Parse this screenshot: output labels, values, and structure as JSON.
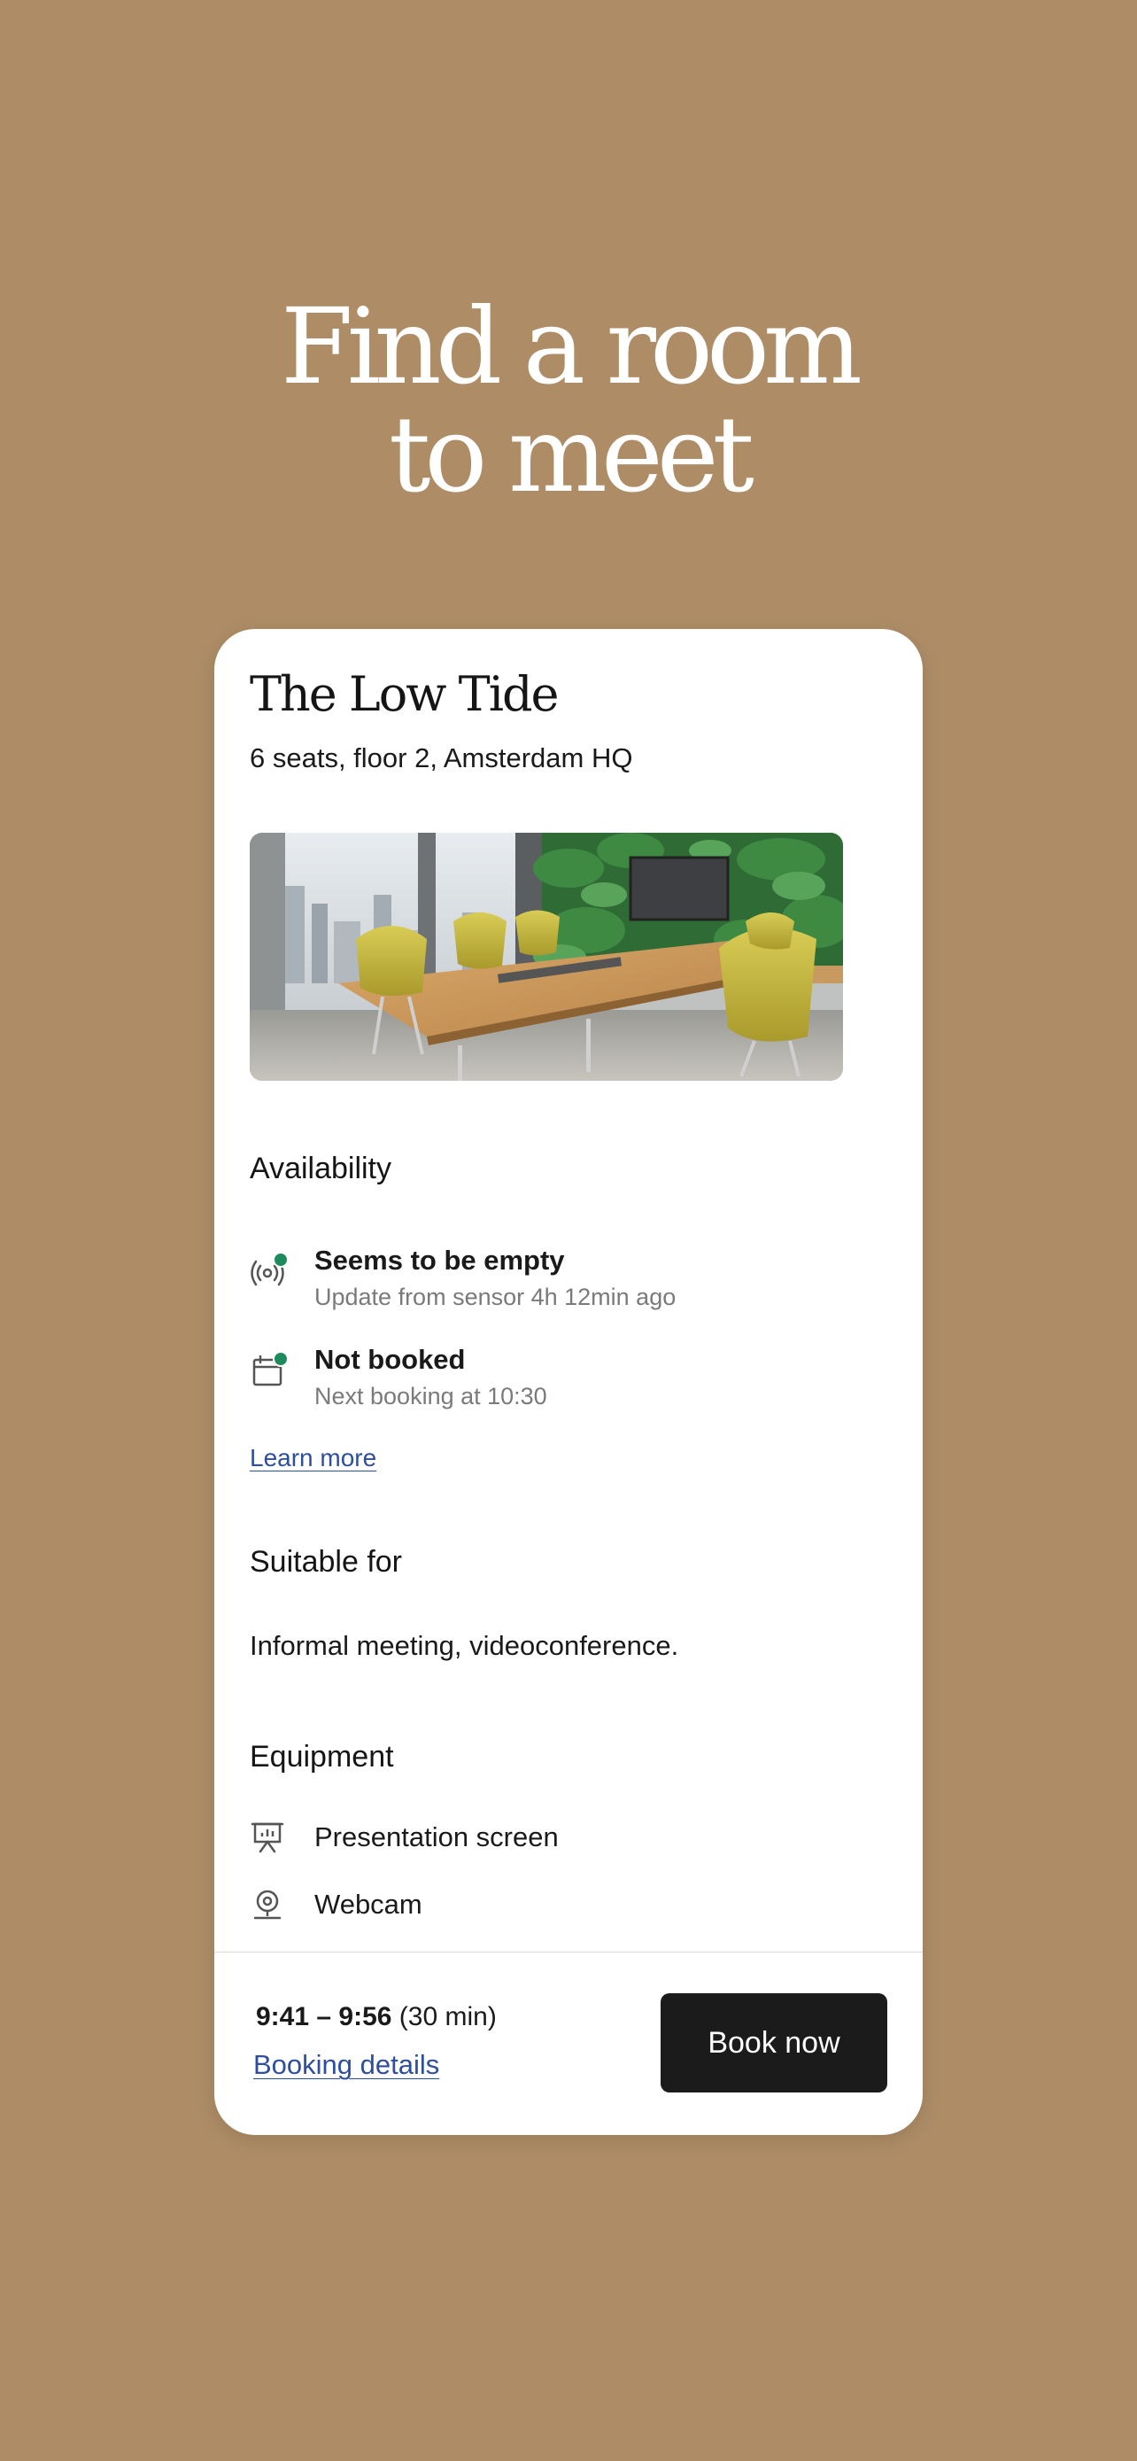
{
  "hero": {
    "line1": "Find a room",
    "line2": "to meet"
  },
  "room": {
    "name": "The Low Tide",
    "details": "6 seats, floor 2, Amsterdam HQ"
  },
  "availability": {
    "heading": "Availability",
    "items": [
      {
        "icon": "sensor-icon",
        "title": "Seems to be empty",
        "subtitle": "Update from sensor 4h 12min ago",
        "status_color": "#1f8a5b"
      },
      {
        "icon": "calendar-icon",
        "title": "Not booked",
        "subtitle": "Next booking at 10:30",
        "status_color": "#1f8a5b"
      }
    ],
    "learn_more": "Learn more"
  },
  "suitable": {
    "heading": "Suitable for",
    "text": "Informal meeting, videoconference."
  },
  "equipment": {
    "heading": "Equipment",
    "items": [
      {
        "icon": "presentation-screen-icon",
        "label": "Presentation screen"
      },
      {
        "icon": "webcam-icon",
        "label": "Webcam"
      }
    ]
  },
  "booking": {
    "time": "9:41 – 9:56",
    "duration": "(30 min)",
    "details_link": "Booking details",
    "button_label": "Book now"
  },
  "colors": {
    "background": "#ae8d66",
    "card": "#ffffff",
    "button": "#1b1b1b",
    "link": "#2e4ea0",
    "status_ok": "#1f8a5b"
  }
}
